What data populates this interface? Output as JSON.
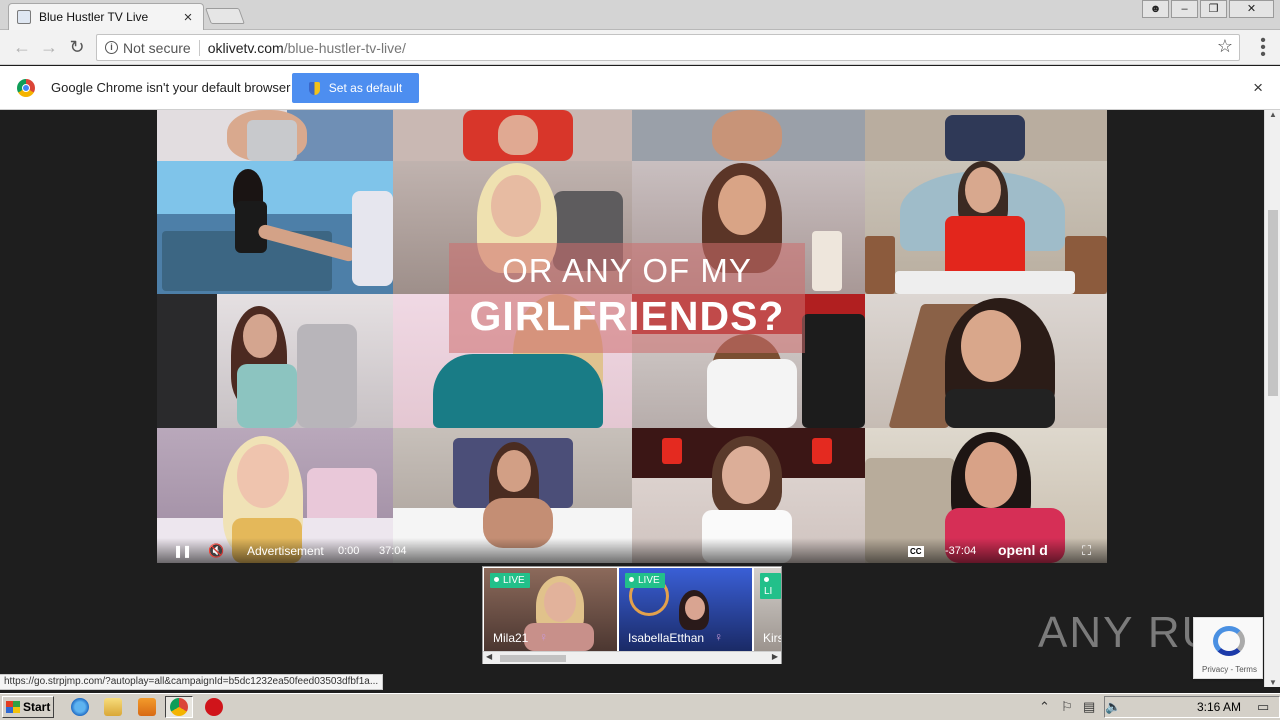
{
  "browser": {
    "tab_title": "Blue Hustler TV Live",
    "tab_close": "×",
    "omnibox": {
      "security_label": "Not secure",
      "url_host": "oklivetv.com",
      "url_path": "/blue-hustler-tv-live/"
    },
    "infobar": {
      "message": "Google Chrome isn't your default browser",
      "button_label": "Set as default",
      "close": "×"
    },
    "status_url": "https://go.strpjmp.com/?autoplay=all&campaignId=b5dc1232ea50feed03503dfbf1a..."
  },
  "video": {
    "promo_line1": "OR ANY OF MY",
    "promo_line2": "GIRLFRIENDS?",
    "ad_label": "Advertisement",
    "time_current": "0:00",
    "time_total": "37:04",
    "time_remaining": "-37:04",
    "cc_label": "CC",
    "brand": "openl   d"
  },
  "live_cards": [
    {
      "badge": "LIVE",
      "name": "Mila21"
    },
    {
      "badge": "LIVE",
      "name": "IsabellaEtthan"
    },
    {
      "badge": "LI",
      "name": "Kirs"
    }
  ],
  "watermark": "ANY RUN",
  "recaptcha": {
    "links": "Privacy - Terms"
  },
  "taskbar": {
    "start_label": "Start",
    "clock": "3:16 AM"
  },
  "icons": {
    "back": "back-arrow-icon",
    "forward": "forward-arrow-icon",
    "reload": "reload-icon",
    "bookmark": "star-icon",
    "menu": "kebab-menu-icon"
  }
}
